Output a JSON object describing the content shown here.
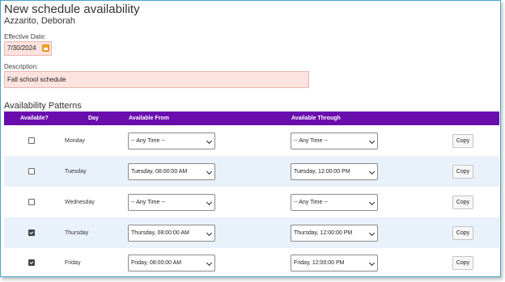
{
  "page": {
    "title": "New schedule availability",
    "person": "Azzarito, Deborah"
  },
  "form": {
    "effective_date_label": "Effective Date:",
    "effective_date_value": "7/30/2024",
    "description_label": "Description:",
    "description_value": "Fall school schedule"
  },
  "patterns": {
    "title": "Availability Patterns",
    "headers": {
      "available": "Available?",
      "day": "Day",
      "from": "Available From",
      "through": "Available Through"
    },
    "copy_label": "Copy",
    "rows": [
      {
        "day": "Monday",
        "available": false,
        "from": "-- Any Time --",
        "through": "-- Any Time --"
      },
      {
        "day": "Tuesday",
        "available": false,
        "from": "Tuesday, 08:00:00 AM",
        "through": "Tuesday, 12:00:00 PM"
      },
      {
        "day": "Wednesday",
        "available": false,
        "from": "-- Any Time --",
        "through": "-- Any Time --"
      },
      {
        "day": "Thursday",
        "available": true,
        "from": "Thursday, 08:00:00 AM",
        "through": "Thursday, 12:00:00 PM"
      },
      {
        "day": "Friday",
        "available": true,
        "from": "Friday, 08:00:00 AM",
        "through": "Friday, 12:00:00 PM"
      }
    ]
  },
  "colors": {
    "header_bg": "#6a0dad",
    "input_bg": "#fde3df",
    "alt_row_bg": "#e9f1fb"
  },
  "icons": {
    "date_picker": "calendar-icon",
    "select_arrow": "chevron-down-icon"
  }
}
